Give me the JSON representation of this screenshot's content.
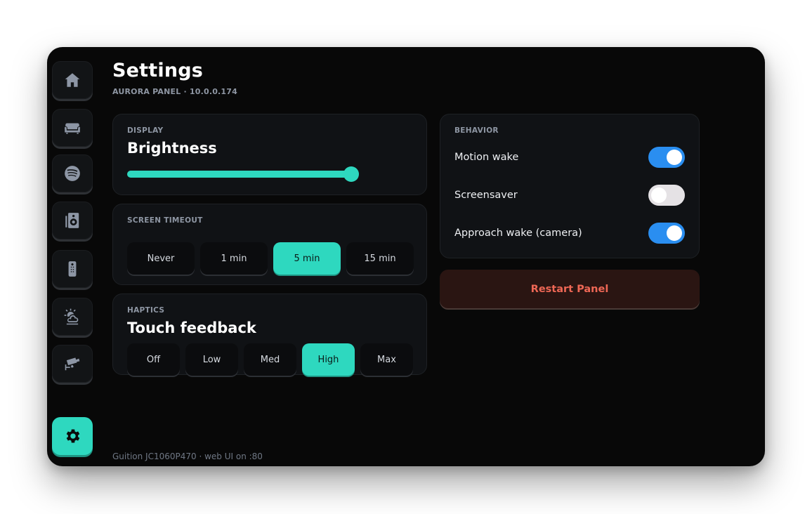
{
  "header": {
    "title": "Settings",
    "subtitle": "AURORA PANEL · 10.0.0.174"
  },
  "sidebar": {
    "items": [
      {
        "icon": "home-icon",
        "active": false
      },
      {
        "icon": "sofa-icon",
        "active": false
      },
      {
        "icon": "spotify-icon",
        "active": false
      },
      {
        "icon": "speaker-icon",
        "active": false
      },
      {
        "icon": "remote-icon",
        "active": false
      },
      {
        "icon": "weather-icon",
        "active": false
      },
      {
        "icon": "camera-icon",
        "active": false
      },
      {
        "icon": "gear-icon",
        "active": true
      }
    ]
  },
  "display": {
    "label": "DISPLAY",
    "heading": "Brightness",
    "brightness": 0.99
  },
  "timeout": {
    "label": "SCREEN TIMEOUT",
    "options": [
      "Never",
      "1 min",
      "5 min",
      "15 min"
    ],
    "selected": "5 min"
  },
  "haptics": {
    "label": "HAPTICS",
    "heading": "Touch feedback",
    "options": [
      "Off",
      "Low",
      "Med",
      "High",
      "Max"
    ],
    "selected": "High"
  },
  "behavior": {
    "label": "BEHAVIOR",
    "toggles": [
      {
        "label": "Motion wake",
        "on": true
      },
      {
        "label": "Screensaver",
        "on": false
      },
      {
        "label": "Approach wake (camera)",
        "on": true
      }
    ]
  },
  "restart_label": "Restart Panel",
  "footer": "Guition JC1060P470 · web UI on :80",
  "colors": {
    "accent": "#2ed8bf",
    "toggle_on": "#2a8ef0",
    "danger": "#ee6755",
    "background": "#080808"
  }
}
